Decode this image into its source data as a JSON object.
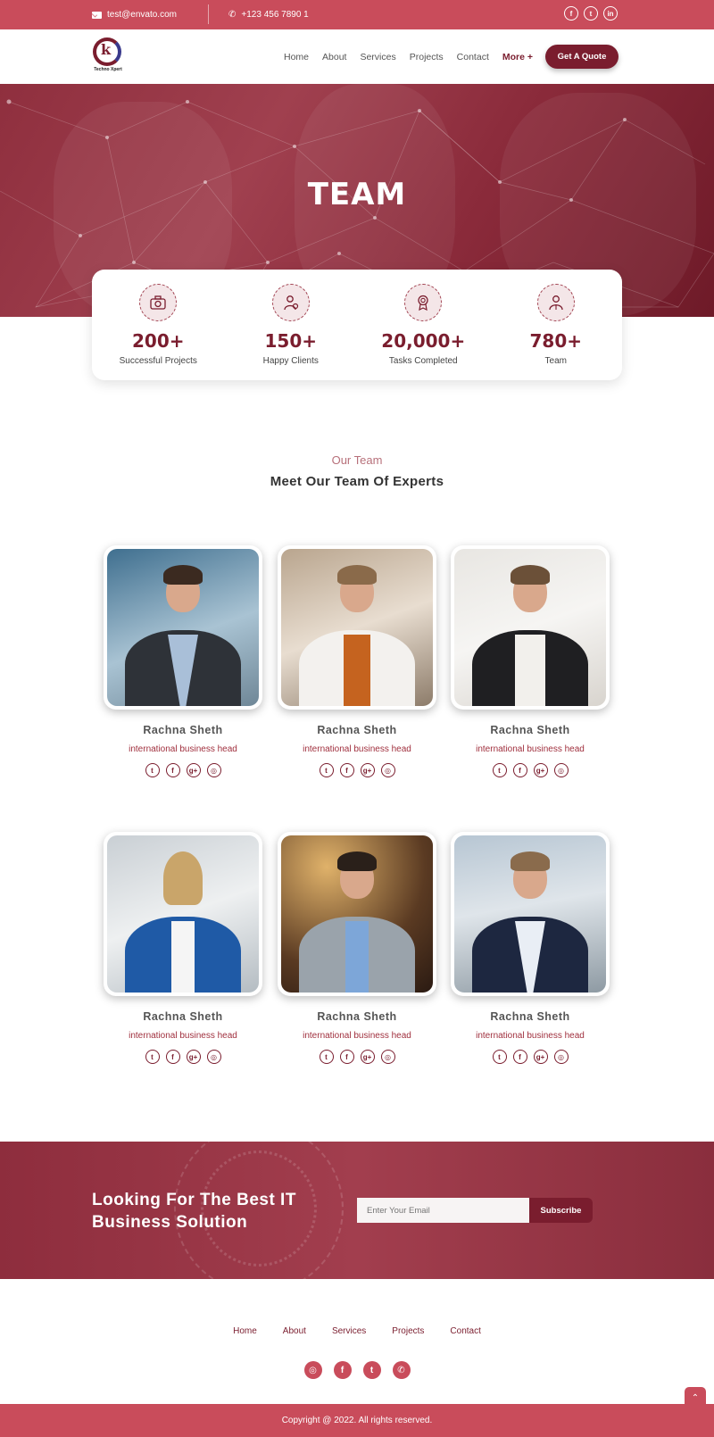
{
  "topbar": {
    "email": "test@envato.com",
    "phone": "+123 456 7890 1",
    "social": [
      {
        "icon": "facebook-icon",
        "glyph": "f"
      },
      {
        "icon": "twitter-icon",
        "glyph": "t"
      },
      {
        "icon": "linkedin-icon",
        "glyph": "in"
      }
    ]
  },
  "header": {
    "logo_text": "Techno Xpert",
    "nav": [
      "Home",
      "About",
      "Services",
      "Projects",
      "Contact"
    ],
    "more_label": "More +",
    "quote_label": "Get A Quote"
  },
  "hero": {
    "title": "TEAM"
  },
  "stats": [
    {
      "value": "200+",
      "label": "Successful Projects",
      "icon": "camera-icon"
    },
    {
      "value": "150+",
      "label": "Happy Clients",
      "icon": "client-icon"
    },
    {
      "value": "20,000+",
      "label": "Tasks Completed",
      "icon": "award-icon"
    },
    {
      "value": "780+",
      "label": "Team",
      "icon": "team-member-icon"
    }
  ],
  "team_section": {
    "subtitle": "Our Team",
    "title": "Meet Our Team Of Experts"
  },
  "team": [
    {
      "name": "Rachna Sheth",
      "role": "international business head"
    },
    {
      "name": "Rachna Sheth",
      "role": "international business head"
    },
    {
      "name": "Rachna Sheth",
      "role": "international business head"
    },
    {
      "name": "Rachna Sheth",
      "role": "international business head"
    },
    {
      "name": "Rachna Sheth",
      "role": "international business head"
    },
    {
      "name": "Rachna Sheth",
      "role": "international business head"
    }
  ],
  "member_social": [
    "twitter-icon",
    "facebook-icon",
    "google-plus-icon",
    "instagram-icon"
  ],
  "cta": {
    "title": "Looking For The Best IT Business Solution",
    "email_placeholder": "Enter Your Email",
    "subscribe_label": "Subscribe"
  },
  "footer": {
    "nav": [
      "Home",
      "About",
      "Services",
      "Projects",
      "Contact"
    ],
    "social": [
      "instagram-icon",
      "facebook-icon",
      "twitter-icon",
      "whatsapp-icon"
    ],
    "copyright": "Copyright @ 2022. All rights reserved."
  },
  "colors": {
    "primary": "#c94c5b",
    "dark": "#7a1d2e"
  }
}
